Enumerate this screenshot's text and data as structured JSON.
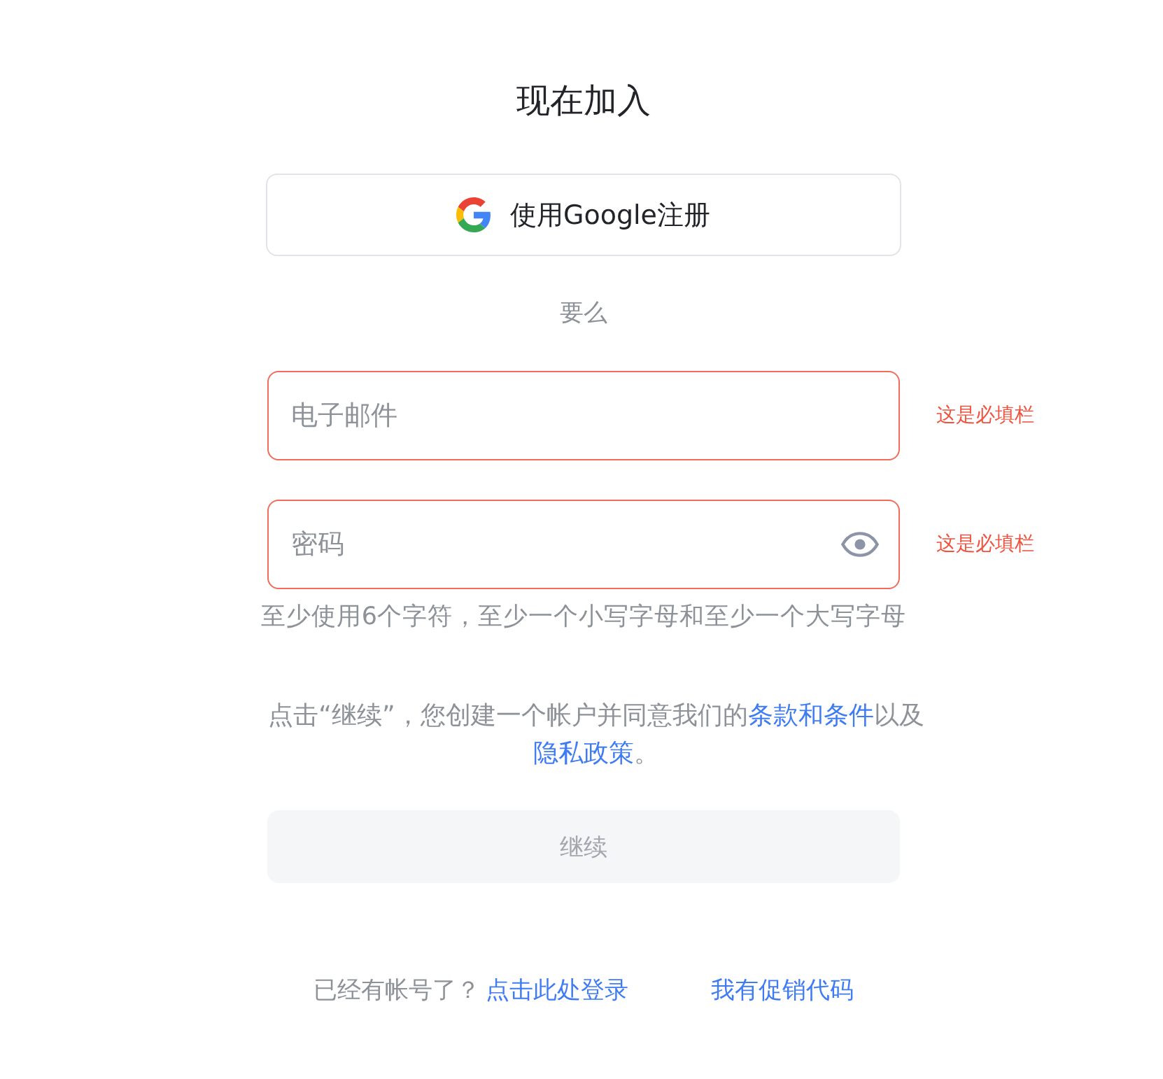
{
  "title": "现在加入",
  "google_button": {
    "label": "使用Google注册"
  },
  "divider_text": "要么",
  "fields": [
    {
      "kind": "text",
      "placeholder": "电子邮件",
      "invalid": true,
      "error": "这是必填栏"
    },
    {
      "kind": "password",
      "placeholder": "密码",
      "invalid": true,
      "error": "这是必填栏",
      "hint": "至少使用6个字符，至少一个小写字母和至少一个大写字母"
    }
  ],
  "consent": [
    {
      "kind": "text",
      "text": "点击“继续”，您创建一个帐户并同意我们的"
    },
    {
      "kind": "link",
      "text": "条款和条件"
    },
    {
      "kind": "text",
      "text": "以及"
    },
    {
      "kind": "link",
      "text": "隐私政策"
    },
    {
      "kind": "text",
      "text": "。"
    }
  ],
  "continue_button": {
    "label": "继续",
    "disabled": true
  },
  "footer": {
    "prompt": "已经有帐号了？",
    "login_link": "点击此处登录",
    "promo_link": "我有促销代码"
  }
}
